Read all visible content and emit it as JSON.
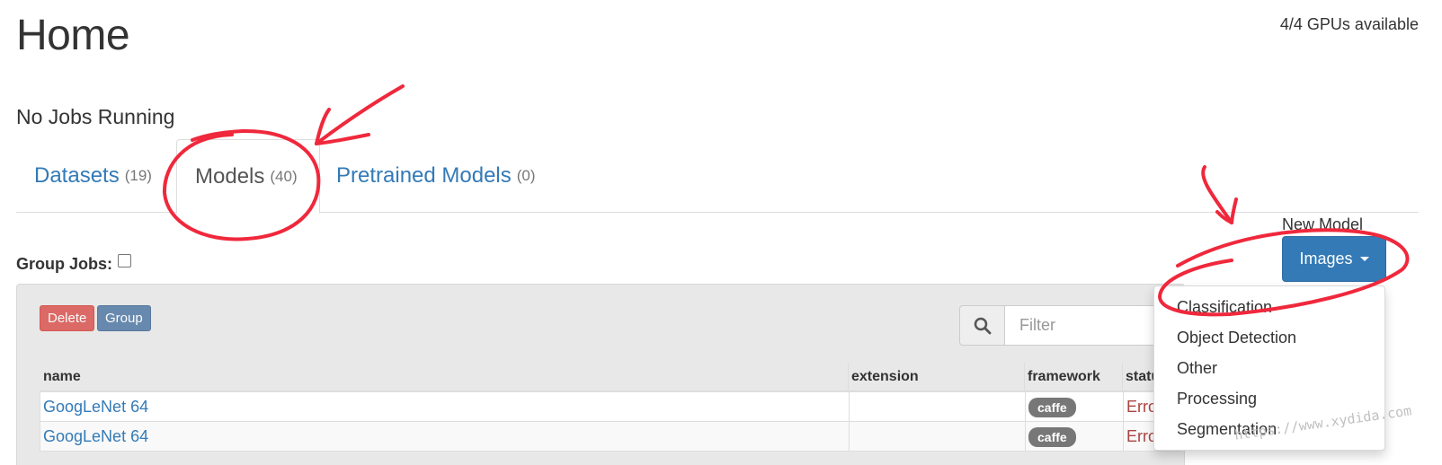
{
  "header": {
    "title": "Home",
    "gpus": "4/4 GPUs available",
    "jobs_status": "No Jobs Running"
  },
  "tabs": [
    {
      "label": "Datasets",
      "count": "(19)",
      "active": false
    },
    {
      "label": "Models",
      "count": "(40)",
      "active": true
    },
    {
      "label": "Pretrained Models",
      "count": "(0)",
      "active": false
    }
  ],
  "controls": {
    "group_jobs_label": "Group Jobs:",
    "group_jobs_checked": false,
    "new_model_label": "New Model",
    "images_button": "Images",
    "delete_button": "Delete",
    "group_button": "Group",
    "filter_placeholder": "Filter",
    "search_icon": "search-icon"
  },
  "dropdown": {
    "items": [
      "Classification",
      "Object Detection",
      "Other",
      "Processing",
      "Segmentation"
    ]
  },
  "table": {
    "columns": [
      "name",
      "extension",
      "framework",
      "statu"
    ],
    "rows": [
      {
        "name": "GoogLeNet 64",
        "extension": "",
        "framework": "caffe",
        "status": "Erro"
      },
      {
        "name": "GoogLeNet 64",
        "extension": "",
        "framework": "caffe",
        "status": "Erro"
      }
    ]
  },
  "watermark": "https://www.xydida.com",
  "colors": {
    "link": "#337ab7",
    "primary": "#337ab7",
    "danger": "#d9534f",
    "annotation": "#f0283c",
    "error": "#a94442"
  }
}
